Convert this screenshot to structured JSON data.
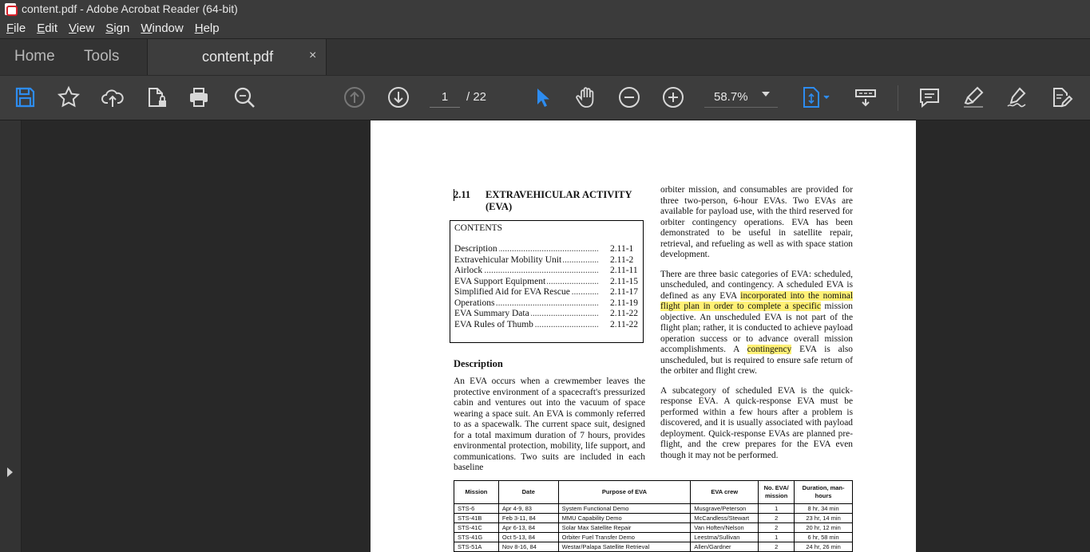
{
  "window": {
    "title": "content.pdf - Adobe Acrobat Reader (64-bit)"
  },
  "menu": [
    {
      "pre": "",
      "u": "F",
      "post": "ile"
    },
    {
      "pre": "",
      "u": "E",
      "post": "dit"
    },
    {
      "pre": "",
      "u": "V",
      "post": "iew"
    },
    {
      "pre": "",
      "u": "S",
      "post": "ign"
    },
    {
      "pre": "",
      "u": "W",
      "post": "indow"
    },
    {
      "pre": "",
      "u": "H",
      "post": "elp"
    }
  ],
  "tabs": {
    "home": "Home",
    "tools": "Tools",
    "document": "content.pdf",
    "close_glyph": "×"
  },
  "toolbar": {
    "page_current": "1",
    "page_total": "/  22",
    "zoom": "58.7%",
    "accent_color": "#2d8cf0",
    "icons": [
      "save-icon",
      "star-icon",
      "cloud-upload-icon",
      "lock-file-icon",
      "print-icon",
      "search-zoom-icon",
      "page-up-icon",
      "page-down-icon",
      "select-cursor-icon",
      "hand-icon",
      "zoom-out-icon",
      "zoom-in-icon",
      "fit-page-icon",
      "scroll-mode-icon",
      "comment-icon",
      "highlight-pen-icon",
      "sign-icon",
      "edit-tools-icon"
    ]
  },
  "document": {
    "section_number": "2.11",
    "section_title": "EXTRAVEHICULAR ACTIVITY (EVA)",
    "contents_heading": "CONTENTS",
    "contents": [
      {
        "title": "Description",
        "page": "2.11-1"
      },
      {
        "title": "Extravehicular Mobility Unit",
        "page": "2.11-2"
      },
      {
        "title": "Airlock",
        "page": "2.11-11"
      },
      {
        "title": "EVA Support Equipment",
        "page": "2.11-15"
      },
      {
        "title": "Simplified Aid for EVA Rescue",
        "page": "2.11-17"
      },
      {
        "title": "Operations",
        "page": "2.11-19"
      },
      {
        "title": "EVA Summary Data",
        "page": "2.11-22"
      },
      {
        "title": "EVA Rules of Thumb",
        "page": "2.11-22"
      }
    ],
    "description_heading": "Description",
    "left_para": "An EVA occurs when a crewmember leaves the protective environment of a spacecraft's pressurized cabin and ventures out into the vacuum of space wearing a space suit.  An EVA is commonly referred to as a spacewalk.  The current space suit, designed for a total maximum duration of 7 hours, provides environmental protection, mobility, life support, and communications.  Two suits are included in each baseline",
    "right_para1": "orbiter mission, and consumables are provided for three two-person, 6-hour EVAs.  Two EVAs are available for payload use, with the third reserved for orbiter contingency operations. EVA has been demonstrated to be useful in satellite repair, retrieval, and refueling as well as with space station development.",
    "right_para2_a": "There are three basic categories of EVA: scheduled, unscheduled, and contingency.  A scheduled EVA is defined as any EVA ",
    "right_para2_hl1": "incorporated into the nominal flight plan in order to complete a specific",
    "right_para2_b": " mission objective.  An unscheduled EVA is not part of the flight plan; rather, it is conducted to achieve payload operation success or to advance overall mission accomplishments.  A ",
    "right_para2_hl2": "contingency",
    "right_para2_c": " EVA is also unscheduled, but is required to ensure safe return of the orbiter and flight crew.",
    "right_para3": "A subcategory of scheduled EVA is the quick-response EVA.  A quick-response EVA must be performed within a few hours after a problem is discovered, and it is usually associated with payload deployment.  Quick-response EVAs are planned pre-flight, and the crew prepares for the EVA even though it may not be performed.",
    "highlight_color": "#fff176",
    "table": {
      "headers": [
        "Mission",
        "Date",
        "Purpose of EVA",
        "EVA crew",
        "No. EVA/ mission",
        "Duration, man-hours"
      ],
      "rows": [
        [
          "STS-6",
          "Apr 4-9, 83",
          "System Functional Demo",
          "Musgrave/Peterson",
          "1",
          "8 hr, 34 min"
        ],
        [
          "STS-41B",
          "Feb 3-11, 84",
          "MMU Capability Demo",
          "McCandless/Stewart",
          "2",
          "23 hr, 14 min"
        ],
        [
          "STS-41C",
          "Apr 6-13, 84",
          "Solar Max Satellite Repair",
          "Van Hoften/Nelson",
          "2",
          "20 hr, 12 min"
        ],
        [
          "STS-41G",
          "Oct 5-13, 84",
          "Orbiter Fuel Transfer Demo",
          "Leestma/Sullivan",
          "1",
          "6 hr, 58 min"
        ],
        [
          "STS-51A",
          "Nov 8-16, 84",
          "Westar/Palapa Satellite Retrieval",
          "Allen/Gardner",
          "2",
          "24 hr, 26 min"
        ]
      ]
    }
  }
}
